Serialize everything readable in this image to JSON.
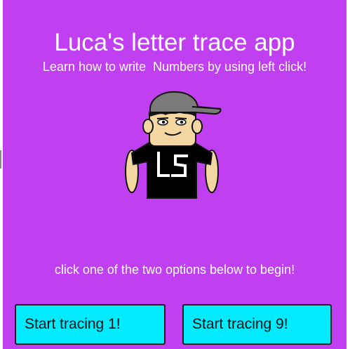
{
  "app": {
    "title": "Luca's letter trace app",
    "subtitle": "Learn how to write  Numbers by using left click!",
    "instruction": "click one of the two options below to begin!",
    "background_color": "#c03ff0",
    "button_color": "#00ebff"
  },
  "avatar": {
    "shirt_logo": "LS",
    "icon": "avatar-icon"
  },
  "buttons": {
    "trace_one_label": "Start tracing 1!",
    "trace_nine_label": "Start tracing 9!"
  }
}
